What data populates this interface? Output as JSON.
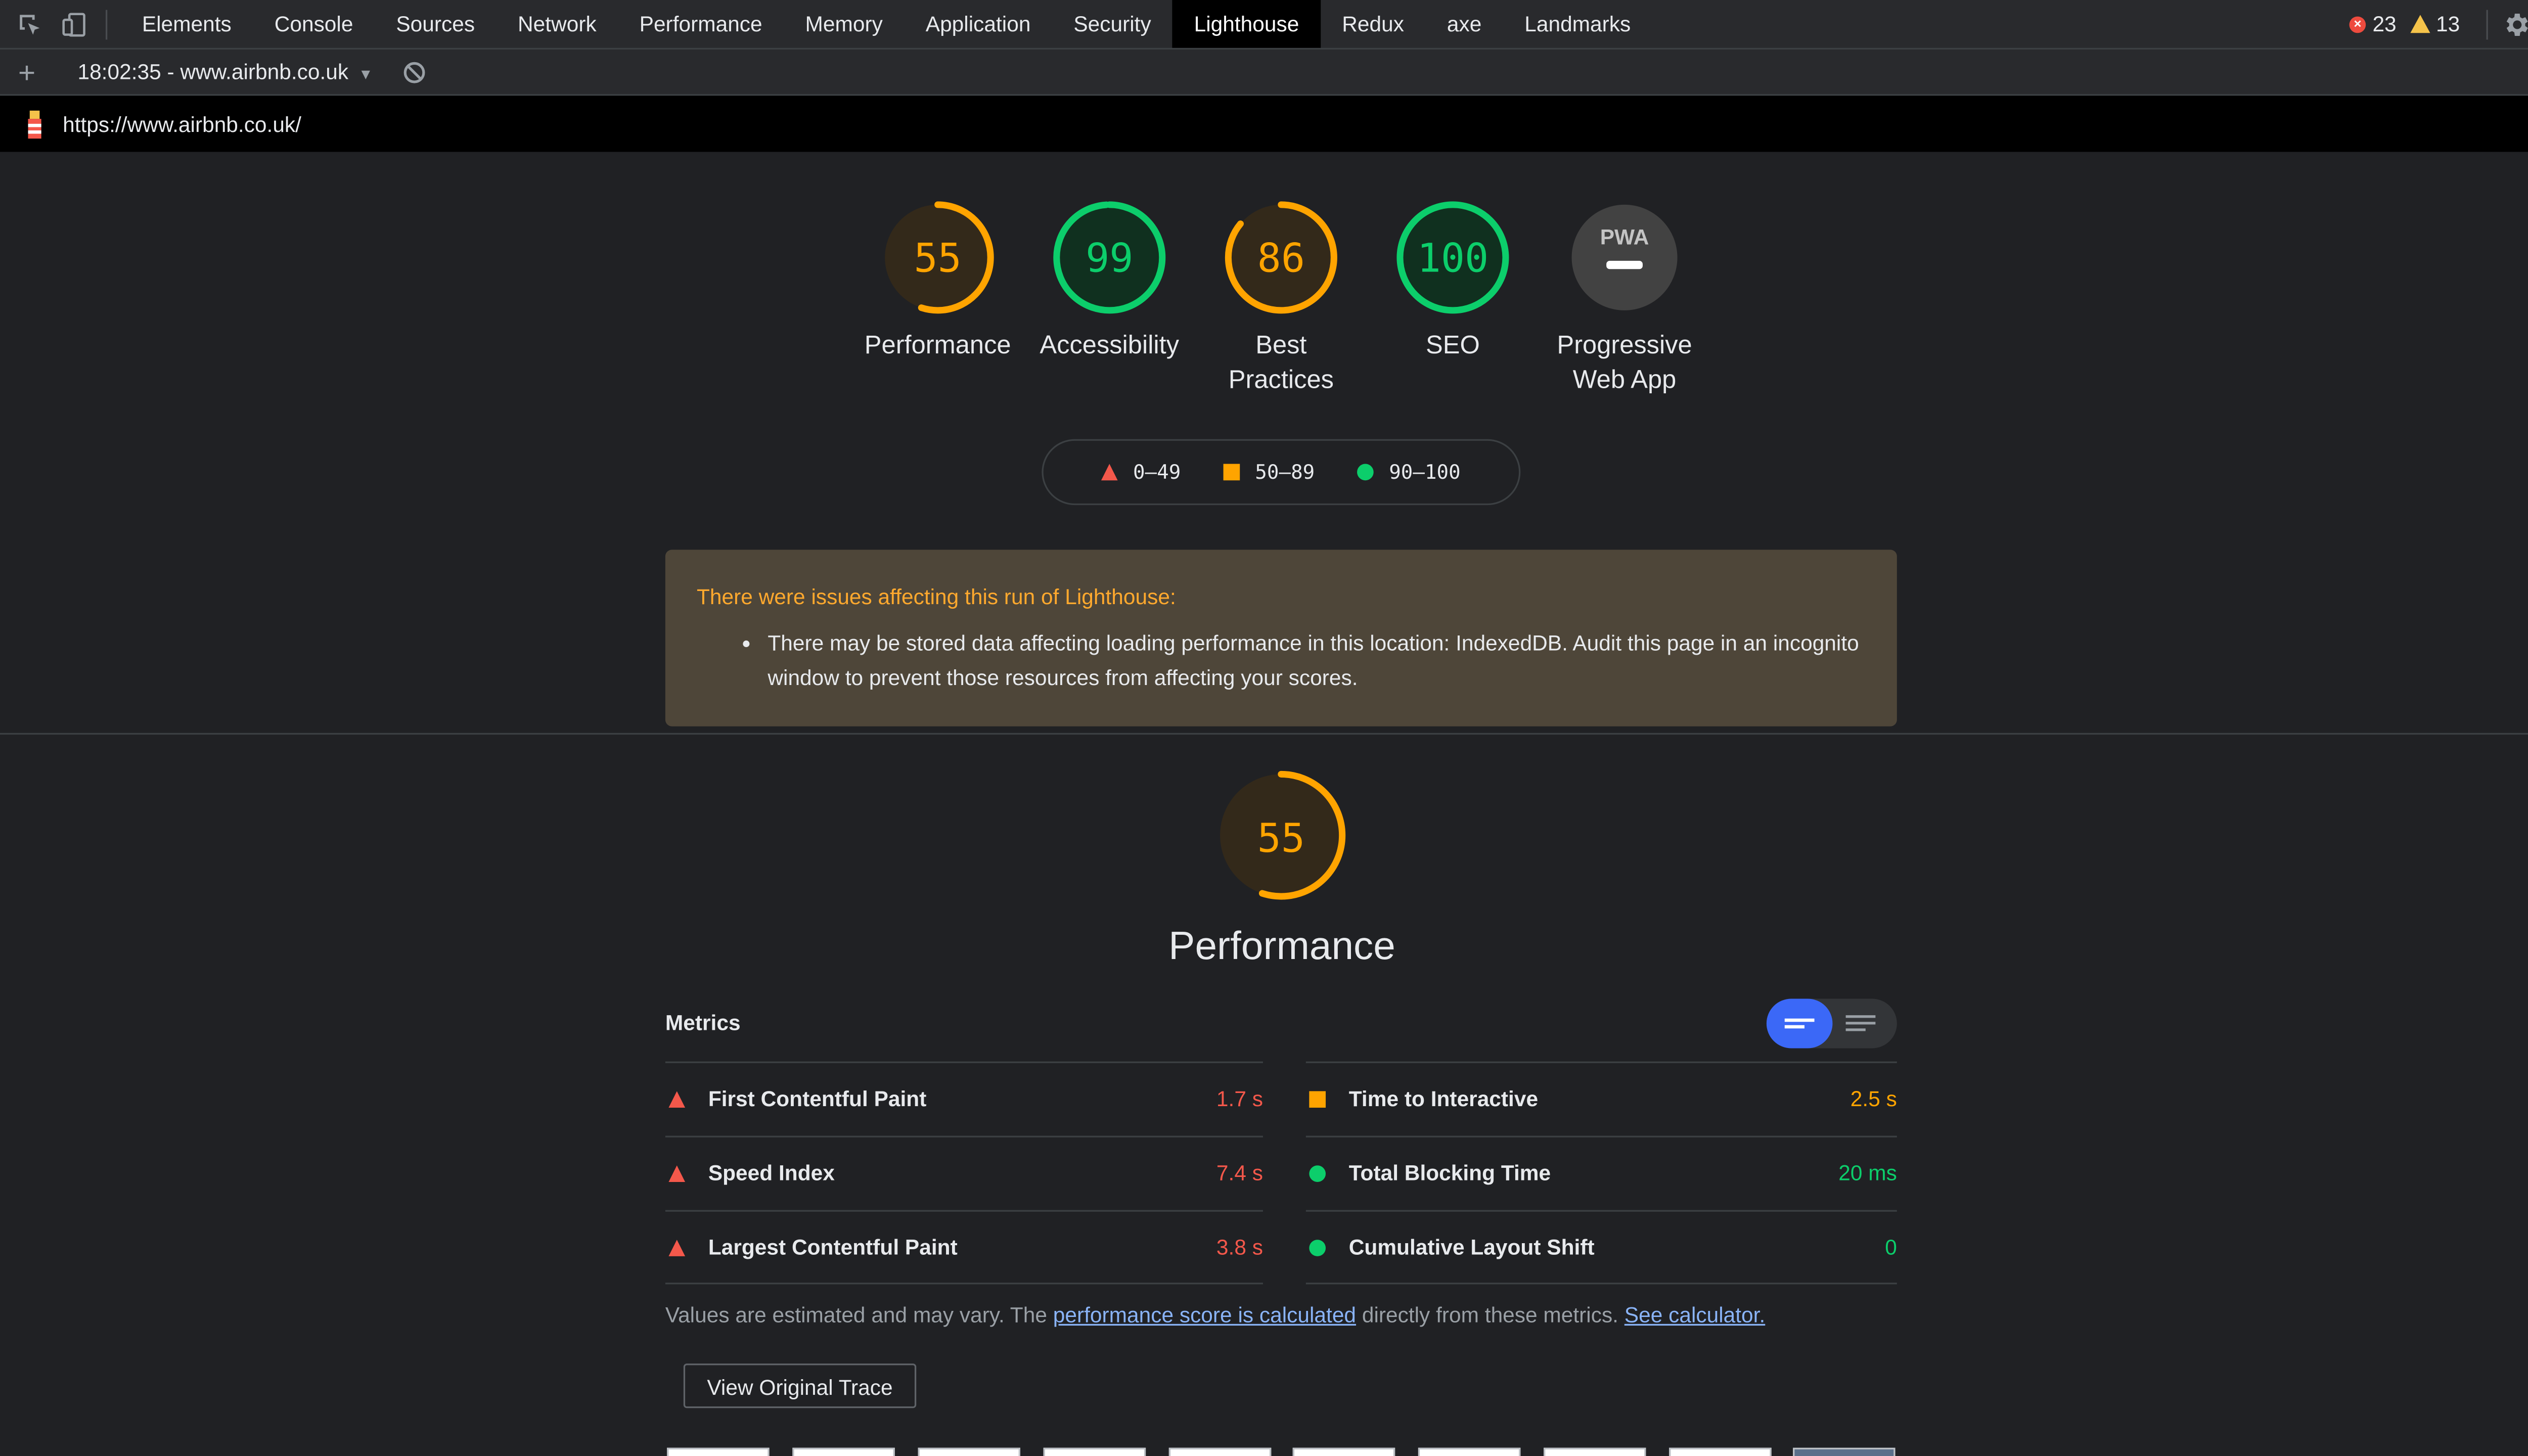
{
  "devtools": {
    "tabs": [
      "Elements",
      "Console",
      "Sources",
      "Network",
      "Performance",
      "Memory",
      "Application",
      "Security",
      "Lighthouse",
      "Redux",
      "axe",
      "Landmarks"
    ],
    "active_tab": "Lighthouse",
    "error_count": "23",
    "warning_count": "13"
  },
  "report_selector": {
    "label": "18:02:35 - www.airbnb.co.uk"
  },
  "url": "https://www.airbnb.co.uk/",
  "categories": [
    {
      "label": "Performance",
      "score": 55,
      "score_text": "55",
      "rating": "average"
    },
    {
      "label": "Accessibility",
      "score": 99,
      "score_text": "99",
      "rating": "pass"
    },
    {
      "label": "Best Practices",
      "score": 86,
      "score_text": "86",
      "rating": "average"
    },
    {
      "label": "SEO",
      "score": 100,
      "score_text": "100",
      "rating": "pass"
    },
    {
      "label": "Progressive Web App",
      "score_text": "PWA",
      "rating": "na"
    }
  ],
  "legend": {
    "fail": "0–49",
    "average": "50–89",
    "pass": "90–100"
  },
  "warning": {
    "title": "There were issues affecting this run of Lighthouse:",
    "item": "There may be stored data affecting loading performance in this location: IndexedDB. Audit this page in an incognito window to prevent those resources from affecting your scores."
  },
  "performance": {
    "score": 55,
    "score_text": "55",
    "title": "Performance",
    "metrics_heading": "Metrics",
    "metrics": [
      {
        "name": "First Contentful Paint",
        "value": "1.7 s",
        "rating": "fail"
      },
      {
        "name": "Time to Interactive",
        "value": "2.5 s",
        "rating": "average"
      },
      {
        "name": "Speed Index",
        "value": "7.4 s",
        "rating": "fail"
      },
      {
        "name": "Total Blocking Time",
        "value": "20 ms",
        "rating": "pass"
      },
      {
        "name": "Largest Contentful Paint",
        "value": "3.8 s",
        "rating": "fail"
      },
      {
        "name": "Cumulative Layout Shift",
        "value": "0",
        "rating": "pass"
      }
    ],
    "note_prefix": "Values are estimated and may vary. The ",
    "note_link1": "performance score is calculated",
    "note_middle": " directly from these metrics. ",
    "note_link2": "See calculator.",
    "trace_button": "View Original Trace"
  },
  "colors": {
    "fail": "#f4584b",
    "average": "#ffa400",
    "pass": "#0cce6b",
    "accent": "#3b68f7"
  }
}
